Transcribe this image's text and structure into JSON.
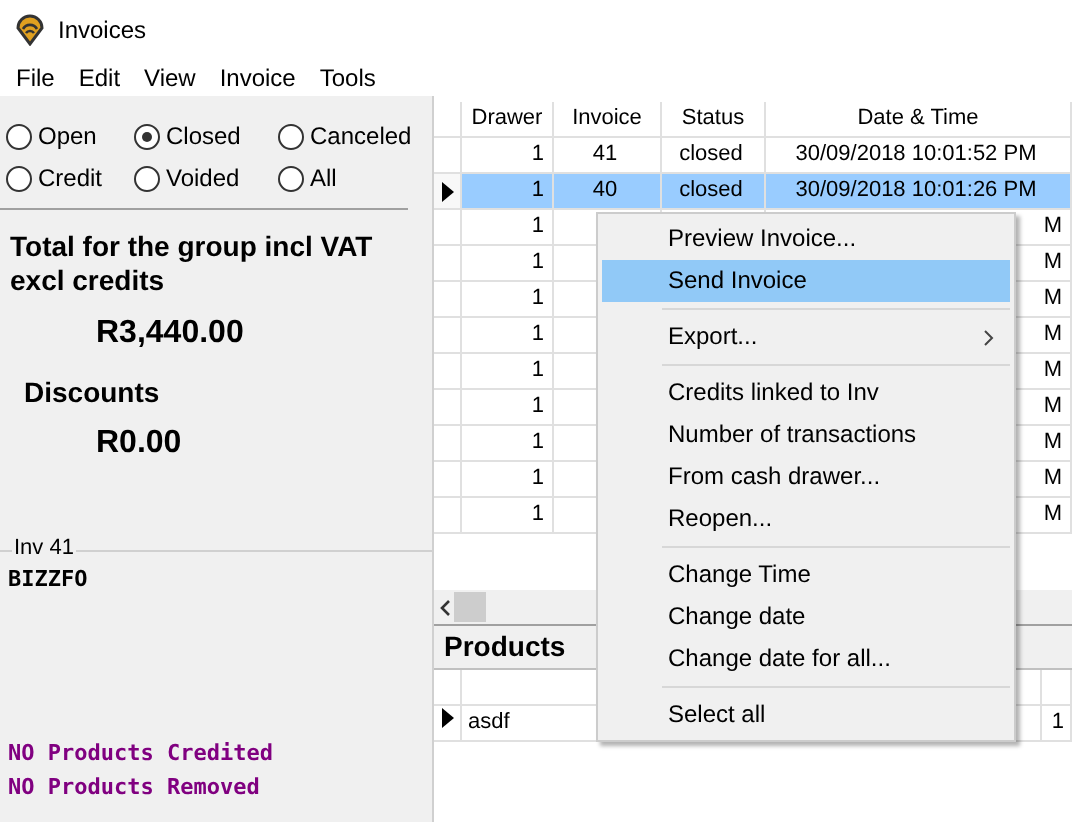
{
  "window": {
    "title": "Invoices"
  },
  "menu_bar": [
    "File",
    "Edit",
    "View",
    "Invoice",
    "Tools"
  ],
  "filters": [
    {
      "label": "Open",
      "selected": false
    },
    {
      "label": "Closed",
      "selected": true
    },
    {
      "label": "Canceled",
      "selected": false
    },
    {
      "label": "Credit",
      "selected": false
    },
    {
      "label": "Voided",
      "selected": false
    },
    {
      "label": "All",
      "selected": false
    }
  ],
  "summary": {
    "total_label": "Total for the group incl VAT excl credits",
    "total": "R3,440.00",
    "discounts_label": "Discounts",
    "discounts": "R0.00"
  },
  "invoice_group": {
    "title": "Inv 41",
    "customer": "BIZZFO",
    "notes": [
      "NO Products Credited",
      "NO Products Removed"
    ]
  },
  "invoices": {
    "columns": [
      "Drawer",
      "Invoice",
      "Status",
      "Date & Time"
    ],
    "rows": [
      {
        "cells": [
          "1",
          "41",
          "closed",
          "30/09/2018 10:01:52 PM"
        ],
        "selected": false
      },
      {
        "cells": [
          "1",
          "40",
          "closed",
          "30/09/2018 10:01:26 PM"
        ],
        "selected": true
      },
      {
        "cells": [
          "1",
          "M"
        ],
        "selected": false
      },
      {
        "cells": [
          "1",
          "M"
        ],
        "selected": false
      },
      {
        "cells": [
          "1",
          "M"
        ],
        "selected": false
      },
      {
        "cells": [
          "1",
          "M"
        ],
        "selected": false
      },
      {
        "cells": [
          "1",
          "M"
        ],
        "selected": false
      },
      {
        "cells": [
          "1",
          "M"
        ],
        "selected": false
      },
      {
        "cells": [
          "1",
          "M"
        ],
        "selected": false
      },
      {
        "cells": [
          "1",
          "M"
        ],
        "selected": false
      },
      {
        "cells": [
          "1",
          "M"
        ],
        "selected": false
      }
    ]
  },
  "products": {
    "title": "Products",
    "rows": [
      {
        "name": "asdf",
        "quantity": "1"
      }
    ]
  },
  "context_menu": [
    {
      "kind": "item",
      "label": "Preview Invoice...",
      "selected": false
    },
    {
      "kind": "item",
      "label": "Send Invoice",
      "selected": true
    },
    {
      "kind": "separator"
    },
    {
      "kind": "item",
      "label": "Export...",
      "selected": false,
      "has_submenu": true
    },
    {
      "kind": "separator"
    },
    {
      "kind": "item",
      "label": "Credits linked to Inv",
      "selected": false
    },
    {
      "kind": "item",
      "label": "Number of transactions",
      "selected": false
    },
    {
      "kind": "item",
      "label": "From cash drawer...",
      "selected": false
    },
    {
      "kind": "item",
      "label": "Reopen...",
      "selected": false
    },
    {
      "kind": "separator"
    },
    {
      "kind": "item",
      "label": "Change Time",
      "selected": false
    },
    {
      "kind": "item",
      "label": "Change date",
      "selected": false
    },
    {
      "kind": "item",
      "label": "Change date for all...",
      "selected": false
    },
    {
      "kind": "separator"
    },
    {
      "kind": "item",
      "label": "Select all",
      "selected": false
    }
  ]
}
